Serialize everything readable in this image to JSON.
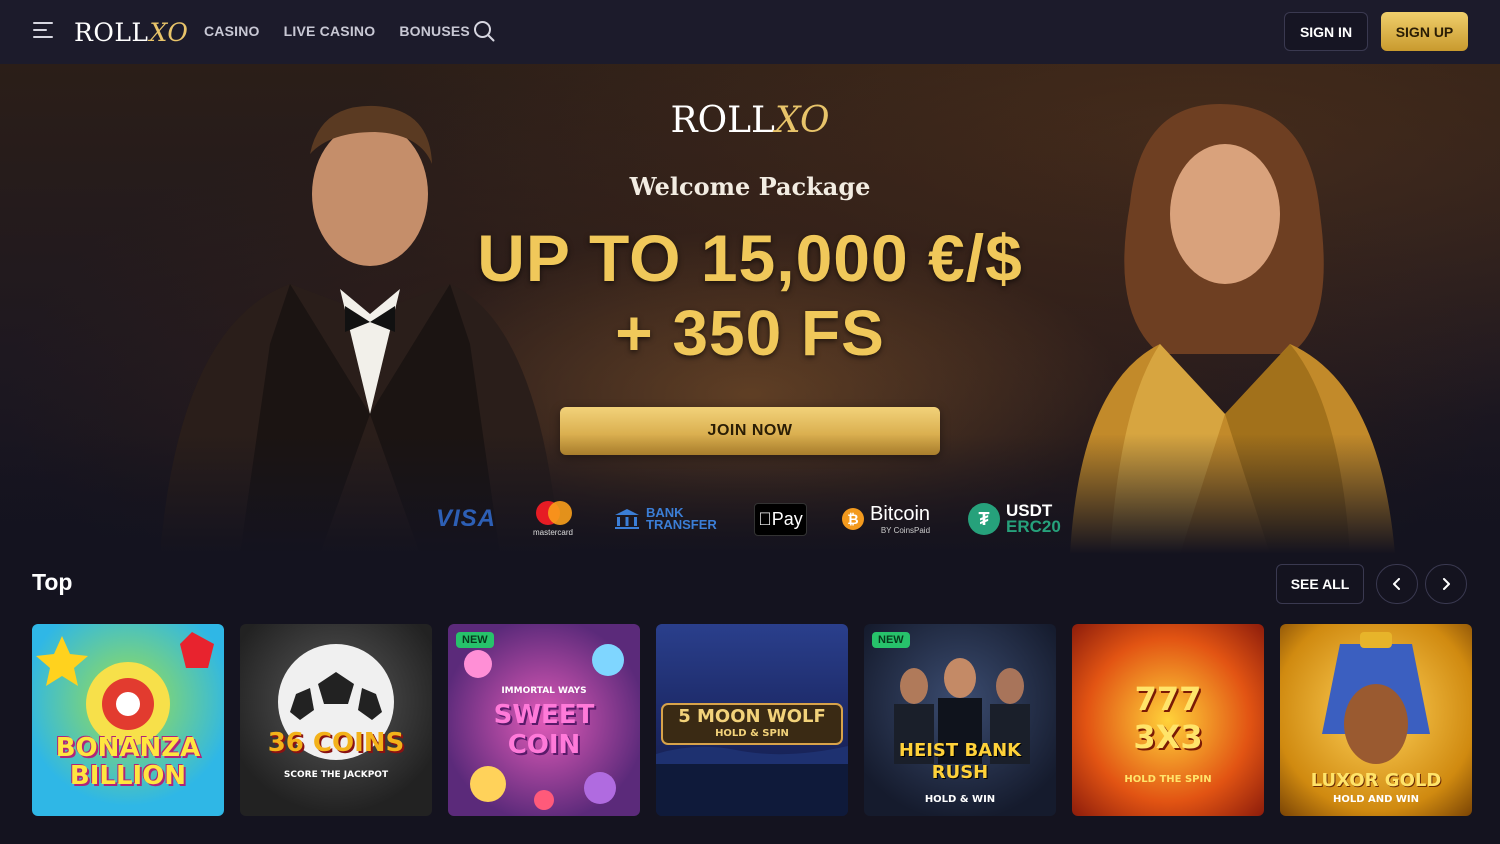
{
  "header": {
    "logo_text": "ROLL",
    "logo_accent": "XO",
    "nav": [
      "CASINO",
      "LIVE CASINO",
      "BONUSES"
    ],
    "sign_in": "SIGN IN",
    "sign_up": "SIGN UP"
  },
  "hero": {
    "logo_text": "ROLL",
    "logo_accent": "XO",
    "subtitle": "Welcome Package",
    "amount": "UP TO 15,000 €/$",
    "free_spins": "+ 350 FS",
    "cta": "JOIN NOW"
  },
  "payments": {
    "visa": "VISA",
    "mastercard": "mastercard",
    "bank_line1": "BANK",
    "bank_line2": "TRANSFER",
    "apple_pay": "Pay",
    "bitcoin": "Bitcoin",
    "bitcoin_sub": "BY CoinsPaid",
    "usdt": "USDT",
    "usdt_sub": "ERC20"
  },
  "top_section": {
    "title": "Top",
    "see_all": "SEE ALL",
    "new_badge": "NEW",
    "games": [
      {
        "title": "BONANZA BILLION"
      },
      {
        "title": "36 COINS",
        "subtitle": "SCORE THE JACKPOT"
      },
      {
        "title": "SWEET COIN",
        "subtitle": "IMMORTAL WAYS"
      },
      {
        "title": "5 MOON WOLF",
        "subtitle": "HOLD & SPIN"
      },
      {
        "title": "HEIST BANK RUSH",
        "subtitle": "HOLD & WIN"
      },
      {
        "title": "777 3X3",
        "subtitle": "HOLD THE SPIN"
      },
      {
        "title": "LUXOR GOLD",
        "subtitle": "HOLD AND WIN"
      }
    ]
  },
  "colors": {
    "gold": "#f0c85a",
    "background": "#14131f",
    "header": "#1c1b2b"
  }
}
